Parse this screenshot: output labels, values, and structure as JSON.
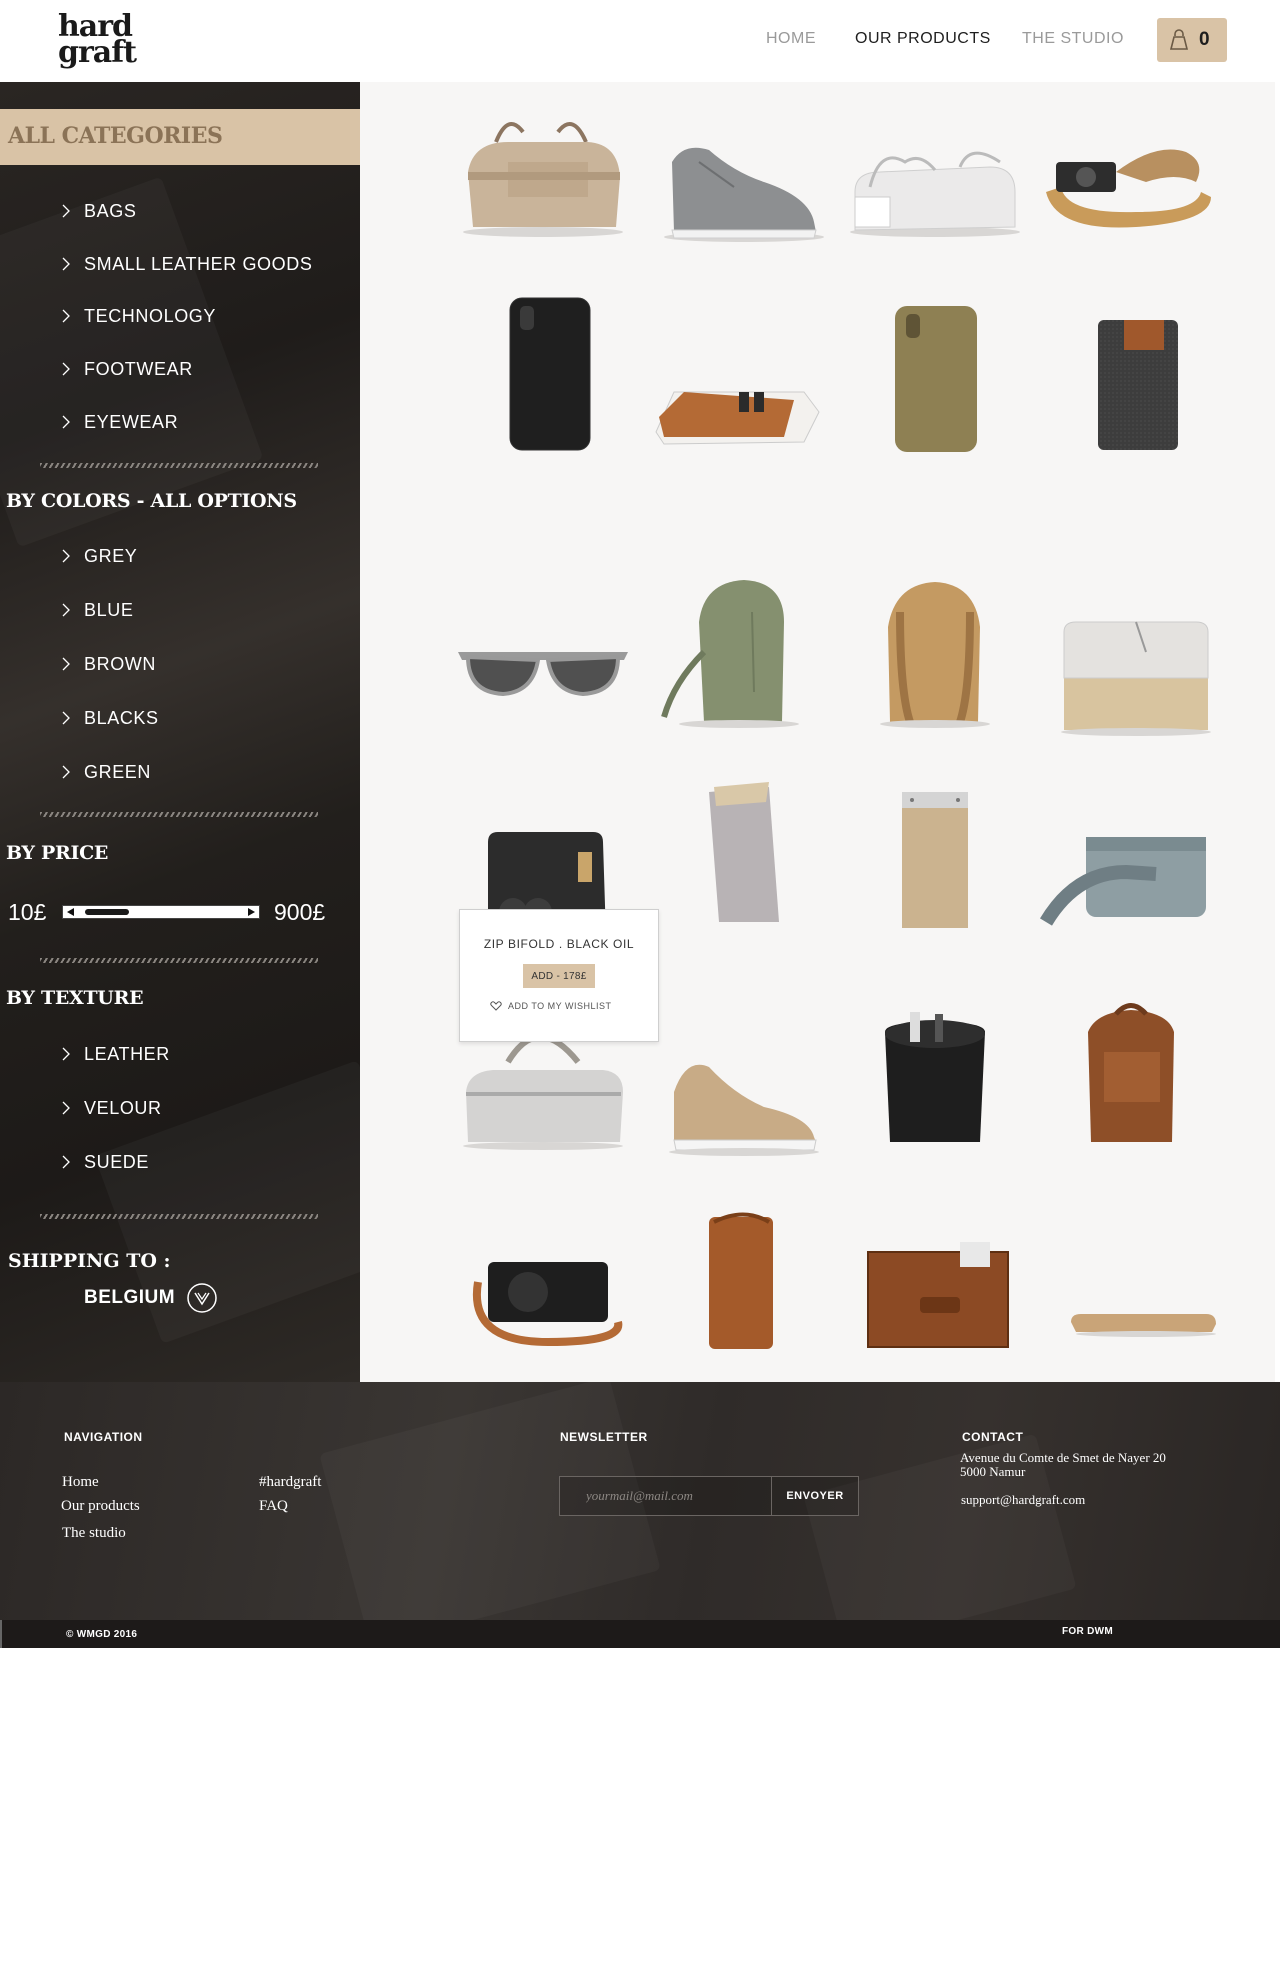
{
  "header": {
    "logo_line1": "hard",
    "logo_line2": "graft",
    "nav": [
      {
        "label": "HOME"
      },
      {
        "label": "OUR PRODUCTS"
      },
      {
        "label": "THE STUDIO"
      }
    ],
    "cart_count": "0",
    "accent_color": "#d9c3a6"
  },
  "sidebar": {
    "categories_title": "ALL CATEGORIES",
    "categories": [
      "BAGS",
      "SMALL LEATHER GOODS",
      "TECHNOLOGY",
      "FOOTWEAR",
      "EYEWEAR"
    ],
    "colors_title": "BY COLORS - ALL OPTIONS",
    "colors": [
      "GREY",
      "BLUE",
      "BROWN",
      "BLACKS",
      "GREEN"
    ],
    "price_title": "BY PRICE",
    "price_min": "10£",
    "price_max": "900£",
    "texture_title": "BY TEXTURE",
    "textures": [
      "LEATHER",
      "VELOUR",
      "SUEDE"
    ],
    "shipping_title": "SHIPPING TO :",
    "shipping_country": "BELGIUM"
  },
  "products": [
    {
      "name": "canvas-holdall",
      "icon": "bag-icon"
    },
    {
      "name": "grey-sneaker",
      "icon": "shoe-icon"
    },
    {
      "name": "white-pouch",
      "icon": "pouch-icon"
    },
    {
      "name": "camera-strap",
      "icon": "strap-icon"
    },
    {
      "name": "black-phone-case",
      "icon": "phone-case-icon"
    },
    {
      "name": "card-wallet",
      "icon": "wallet-icon"
    },
    {
      "name": "olive-phone-case",
      "icon": "phone-case-icon"
    },
    {
      "name": "felt-phone-sleeve",
      "icon": "sleeve-icon"
    },
    {
      "name": "sunglasses",
      "icon": "sunglasses-icon"
    },
    {
      "name": "green-backpack",
      "icon": "backpack-icon"
    },
    {
      "name": "tan-backpack",
      "icon": "backpack-icon"
    },
    {
      "name": "laptop-sleeve",
      "icon": "laptop-sleeve-icon"
    },
    {
      "name": "zip-bifold-black-oil",
      "icon": "wallet-icon"
    },
    {
      "name": "grey-phone-sleeve",
      "icon": "sleeve-icon"
    },
    {
      "name": "tablet-sleeve",
      "icon": "sleeve-icon"
    },
    {
      "name": "blue-camera-bag",
      "icon": "camera-bag-icon"
    },
    {
      "name": "grey-duffel",
      "icon": "bag-icon"
    },
    {
      "name": "tan-sneaker",
      "icon": "shoe-icon"
    },
    {
      "name": "black-bucket-bag",
      "icon": "bag-icon"
    },
    {
      "name": "brown-backpack",
      "icon": "backpack-icon"
    },
    {
      "name": "camera-with-strap",
      "icon": "camera-icon"
    },
    {
      "name": "brown-phone-sleeve",
      "icon": "sleeve-icon"
    },
    {
      "name": "leather-folio",
      "icon": "folio-icon"
    },
    {
      "name": "tan-phone-case",
      "icon": "phone-case-icon"
    }
  ],
  "tooltip": {
    "product_name": "ZIP BIFOLD . BLACK OIL",
    "add_label": "ADD - 178£",
    "wishlist_label": "ADD TO MY WISHLIST"
  },
  "footer": {
    "nav_title": "NAVIGATION",
    "nav_links": [
      "Home",
      "Our products",
      "The studio"
    ],
    "nav_links_2": [
      "#hardgraft",
      "FAQ"
    ],
    "newsletter_title": "NEWSLETTER",
    "newsletter_placeholder": "yourmail@mail.com",
    "newsletter_button": "ENVOYER",
    "contact_title": "CONTACT",
    "contact_address_1": "Avenue du Comte de Smet de Nayer 20",
    "contact_address_2": "5000 Namur",
    "contact_email": "support@hardgraft.com",
    "copyright": "© WMGD 2016",
    "credit": "FOR DWM"
  }
}
